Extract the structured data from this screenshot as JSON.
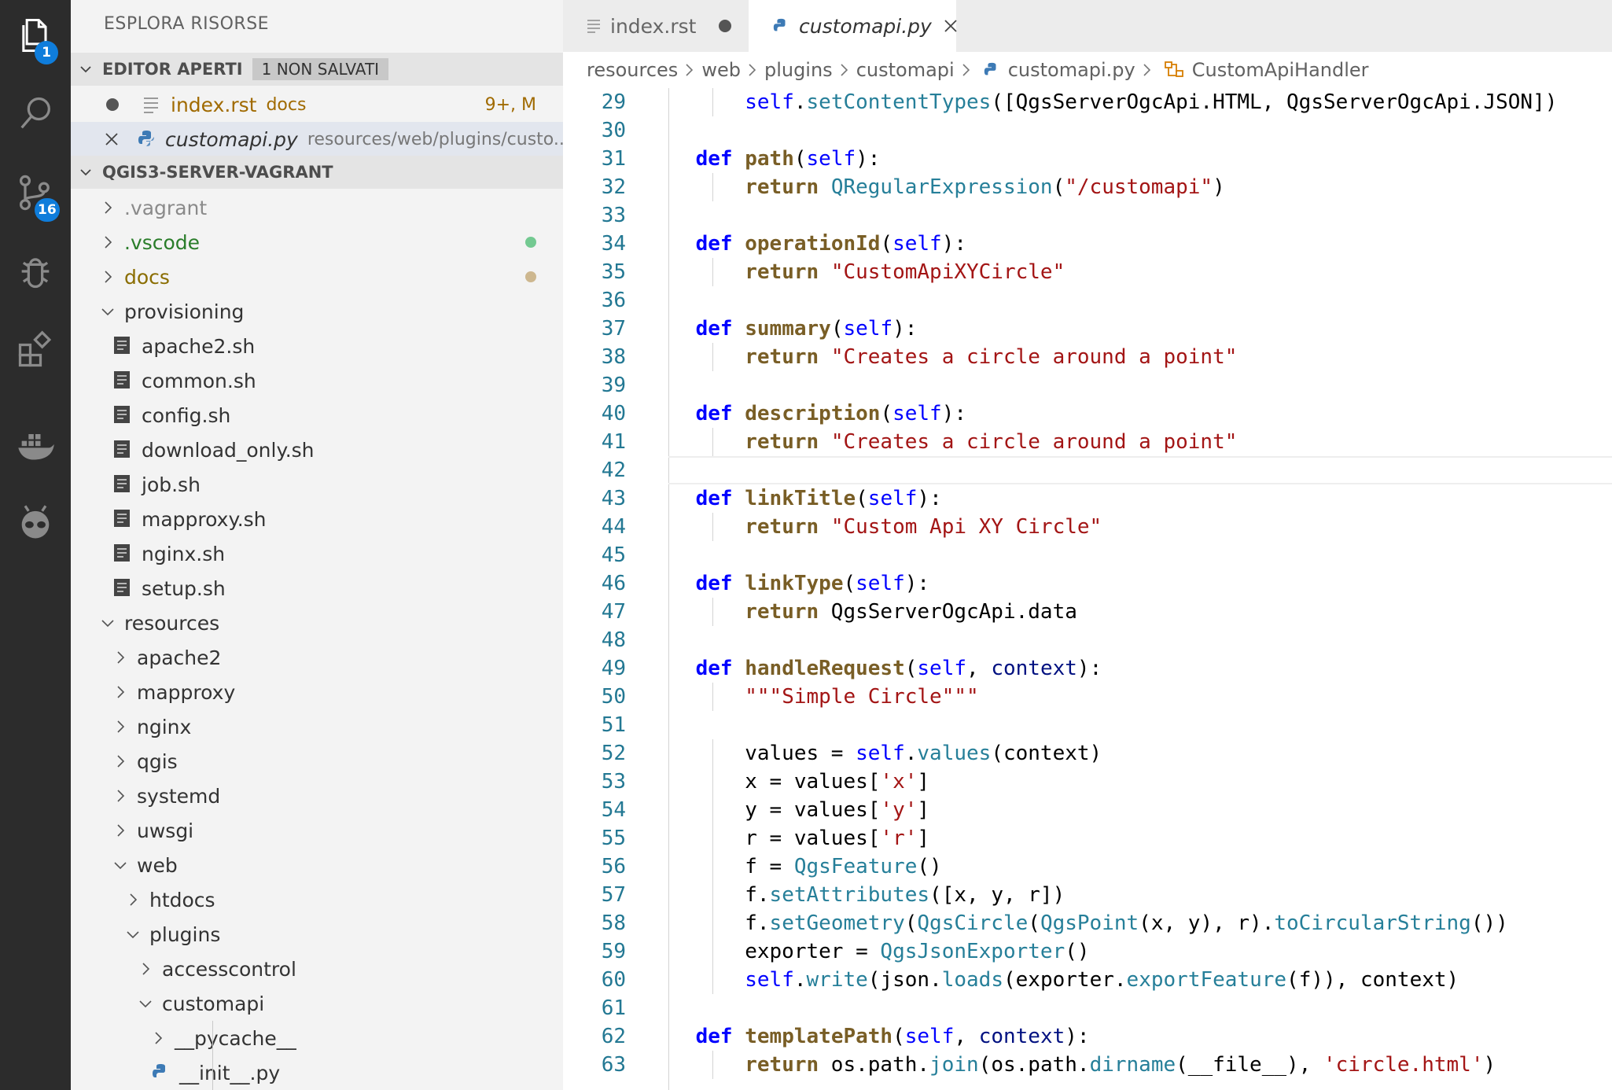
{
  "activity_bar": {
    "explorer_badge": "1",
    "scm_badge": "16",
    "icons": [
      "files-icon",
      "search-icon",
      "source-control-icon",
      "debug-icon",
      "extensions-icon",
      "docker-icon",
      "alien-icon"
    ]
  },
  "sidebar": {
    "title": "ESPLORA RISORSE",
    "open_editors": {
      "header": "EDITOR APERTI",
      "unsaved_badge": "1 NON SALVATI",
      "items": [
        {
          "name": "index.rst",
          "desc": "docs",
          "status": "9+, M"
        },
        {
          "name": "customapi.py",
          "desc": "resources/web/plugins/custo..."
        }
      ]
    },
    "workspace": {
      "header": "QGIS3-SERVER-VAGRANT",
      "tree": [
        {
          "label": ".vagrant",
          "depth": 0,
          "type": "folder",
          "open": false
        },
        {
          "label": ".vscode",
          "depth": 0,
          "type": "folder",
          "open": false
        },
        {
          "label": "docs",
          "depth": 0,
          "type": "folder",
          "open": false
        },
        {
          "label": "provisioning",
          "depth": 0,
          "type": "folder",
          "open": true
        },
        {
          "label": "apache2.sh",
          "depth": 1,
          "type": "file"
        },
        {
          "label": "common.sh",
          "depth": 1,
          "type": "file"
        },
        {
          "label": "config.sh",
          "depth": 1,
          "type": "file"
        },
        {
          "label": "download_only.sh",
          "depth": 1,
          "type": "file"
        },
        {
          "label": "job.sh",
          "depth": 1,
          "type": "file"
        },
        {
          "label": "mapproxy.sh",
          "depth": 1,
          "type": "file"
        },
        {
          "label": "nginx.sh",
          "depth": 1,
          "type": "file"
        },
        {
          "label": "setup.sh",
          "depth": 1,
          "type": "file"
        },
        {
          "label": "resources",
          "depth": 0,
          "type": "folder",
          "open": true
        },
        {
          "label": "apache2",
          "depth": 1,
          "type": "folder",
          "open": false
        },
        {
          "label": "mapproxy",
          "depth": 1,
          "type": "folder",
          "open": false
        },
        {
          "label": "nginx",
          "depth": 1,
          "type": "folder",
          "open": false
        },
        {
          "label": "qgis",
          "depth": 1,
          "type": "folder",
          "open": false
        },
        {
          "label": "systemd",
          "depth": 1,
          "type": "folder",
          "open": false
        },
        {
          "label": "uwsgi",
          "depth": 1,
          "type": "folder",
          "open": false
        },
        {
          "label": "web",
          "depth": 1,
          "type": "folder",
          "open": true
        },
        {
          "label": "htdocs",
          "depth": 2,
          "type": "folder",
          "open": false
        },
        {
          "label": "plugins",
          "depth": 2,
          "type": "folder",
          "open": true
        },
        {
          "label": "accesscontrol",
          "depth": 3,
          "type": "folder",
          "open": false
        },
        {
          "label": "customapi",
          "depth": 3,
          "type": "folder",
          "open": true
        },
        {
          "label": "__pycache__",
          "depth": 4,
          "type": "folder",
          "open": false
        },
        {
          "label": "__init__.py",
          "depth": 4,
          "type": "pyfile"
        }
      ]
    }
  },
  "tabs": [
    {
      "label": "index.rst",
      "dirty": true
    },
    {
      "label": "customapi.py",
      "active": true
    }
  ],
  "breadcrumb": [
    "resources",
    "web",
    "plugins",
    "customapi",
    "customapi.py",
    "CustomApiHandler"
  ],
  "editor": {
    "first_line": 29,
    "lines": [
      [
        [
          "        ",
          "plain"
        ],
        [
          "self",
          "self"
        ],
        [
          ".",
          "plain"
        ],
        [
          "setContentTypes",
          "mth"
        ],
        [
          "([QgsServerOgcApi.HTML, QgsServerOgcApi.JSON])",
          "plain"
        ]
      ],
      [],
      [
        [
          "    ",
          "plain"
        ],
        [
          "def",
          "kw"
        ],
        [
          " ",
          "plain"
        ],
        [
          "path",
          "fn"
        ],
        [
          "(",
          "plain"
        ],
        [
          "self",
          "self"
        ],
        [
          "):",
          "plain"
        ]
      ],
      [
        [
          "        ",
          "plain"
        ],
        [
          "return",
          "ret"
        ],
        [
          " ",
          "plain"
        ],
        [
          "QRegularExpression",
          "cls"
        ],
        [
          "(",
          "plain"
        ],
        [
          "\"/customapi\"",
          "str"
        ],
        [
          ")",
          "plain"
        ]
      ],
      [],
      [
        [
          "    ",
          "plain"
        ],
        [
          "def",
          "kw"
        ],
        [
          " ",
          "plain"
        ],
        [
          "operationId",
          "fn"
        ],
        [
          "(",
          "plain"
        ],
        [
          "self",
          "self"
        ],
        [
          "):",
          "plain"
        ]
      ],
      [
        [
          "        ",
          "plain"
        ],
        [
          "return",
          "ret"
        ],
        [
          " ",
          "plain"
        ],
        [
          "\"CustomApiXYCircle\"",
          "str"
        ]
      ],
      [],
      [
        [
          "    ",
          "plain"
        ],
        [
          "def",
          "kw"
        ],
        [
          " ",
          "plain"
        ],
        [
          "summary",
          "fn"
        ],
        [
          "(",
          "plain"
        ],
        [
          "self",
          "self"
        ],
        [
          "):",
          "plain"
        ]
      ],
      [
        [
          "        ",
          "plain"
        ],
        [
          "return",
          "ret"
        ],
        [
          " ",
          "plain"
        ],
        [
          "\"Creates a circle around a point\"",
          "str"
        ]
      ],
      [],
      [
        [
          "    ",
          "plain"
        ],
        [
          "def",
          "kw"
        ],
        [
          " ",
          "plain"
        ],
        [
          "description",
          "fn"
        ],
        [
          "(",
          "plain"
        ],
        [
          "self",
          "self"
        ],
        [
          "):",
          "plain"
        ]
      ],
      [
        [
          "        ",
          "plain"
        ],
        [
          "return",
          "ret"
        ],
        [
          " ",
          "plain"
        ],
        [
          "\"Creates a circle around a point\"",
          "str"
        ]
      ],
      [],
      [
        [
          "    ",
          "plain"
        ],
        [
          "def",
          "kw"
        ],
        [
          " ",
          "plain"
        ],
        [
          "linkTitle",
          "fn"
        ],
        [
          "(",
          "plain"
        ],
        [
          "self",
          "self"
        ],
        [
          "):",
          "plain"
        ]
      ],
      [
        [
          "        ",
          "plain"
        ],
        [
          "return",
          "ret"
        ],
        [
          " ",
          "plain"
        ],
        [
          "\"Custom Api XY Circle\"",
          "str"
        ]
      ],
      [],
      [
        [
          "    ",
          "plain"
        ],
        [
          "def",
          "kw"
        ],
        [
          " ",
          "plain"
        ],
        [
          "linkType",
          "fn"
        ],
        [
          "(",
          "plain"
        ],
        [
          "self",
          "self"
        ],
        [
          "):",
          "plain"
        ]
      ],
      [
        [
          "        ",
          "plain"
        ],
        [
          "return",
          "ret"
        ],
        [
          " QgsServerOgcApi.data",
          "plain"
        ]
      ],
      [],
      [
        [
          "    ",
          "plain"
        ],
        [
          "def",
          "kw"
        ],
        [
          " ",
          "plain"
        ],
        [
          "handleRequest",
          "fn"
        ],
        [
          "(",
          "plain"
        ],
        [
          "self",
          "self"
        ],
        [
          ", ",
          "plain"
        ],
        [
          "context",
          "param"
        ],
        [
          "):",
          "plain"
        ]
      ],
      [
        [
          "        ",
          "plain"
        ],
        [
          "\"\"\"Simple Circle\"\"\"",
          "str"
        ]
      ],
      [],
      [
        [
          "        values = ",
          "plain"
        ],
        [
          "self",
          "self"
        ],
        [
          ".",
          "plain"
        ],
        [
          "values",
          "mth"
        ],
        [
          "(context)",
          "plain"
        ]
      ],
      [
        [
          "        x = values[",
          "plain"
        ],
        [
          "'x'",
          "str"
        ],
        [
          "]",
          "plain"
        ]
      ],
      [
        [
          "        y = values[",
          "plain"
        ],
        [
          "'y'",
          "str"
        ],
        [
          "]",
          "plain"
        ]
      ],
      [
        [
          "        r = values[",
          "plain"
        ],
        [
          "'r'",
          "str"
        ],
        [
          "]",
          "plain"
        ]
      ],
      [
        [
          "        f = ",
          "plain"
        ],
        [
          "QgsFeature",
          "cls"
        ],
        [
          "()",
          "plain"
        ]
      ],
      [
        [
          "        f.",
          "plain"
        ],
        [
          "setAttributes",
          "mth"
        ],
        [
          "([x, y, r])",
          "plain"
        ]
      ],
      [
        [
          "        f.",
          "plain"
        ],
        [
          "setGeometry",
          "mth"
        ],
        [
          "(",
          "plain"
        ],
        [
          "QgsCircle",
          "cls"
        ],
        [
          "(",
          "plain"
        ],
        [
          "QgsPoint",
          "cls"
        ],
        [
          "(x, y), r).",
          "plain"
        ],
        [
          "toCircularString",
          "mth"
        ],
        [
          "())",
          "plain"
        ]
      ],
      [
        [
          "        exporter = ",
          "plain"
        ],
        [
          "QgsJsonExporter",
          "cls"
        ],
        [
          "()",
          "plain"
        ]
      ],
      [
        [
          "        ",
          "plain"
        ],
        [
          "self",
          "self"
        ],
        [
          ".",
          "plain"
        ],
        [
          "write",
          "mth"
        ],
        [
          "(json.",
          "plain"
        ],
        [
          "loads",
          "mth"
        ],
        [
          "(exporter.",
          "plain"
        ],
        [
          "exportFeature",
          "mth"
        ],
        [
          "(f)), context)",
          "plain"
        ]
      ],
      [],
      [
        [
          "    ",
          "plain"
        ],
        [
          "def",
          "kw"
        ],
        [
          " ",
          "plain"
        ],
        [
          "templatePath",
          "fn"
        ],
        [
          "(",
          "plain"
        ],
        [
          "self",
          "self"
        ],
        [
          ", ",
          "plain"
        ],
        [
          "context",
          "param"
        ],
        [
          "):",
          "plain"
        ]
      ],
      [
        [
          "        ",
          "plain"
        ],
        [
          "return",
          "ret"
        ],
        [
          " os.path.",
          "plain"
        ],
        [
          "join",
          "mth"
        ],
        [
          "(os.path.",
          "plain"
        ],
        [
          "dirname",
          "mth"
        ],
        [
          "(__file__), ",
          "plain"
        ],
        [
          "'circle.html'",
          "str"
        ],
        [
          ")",
          "plain"
        ]
      ]
    ]
  }
}
